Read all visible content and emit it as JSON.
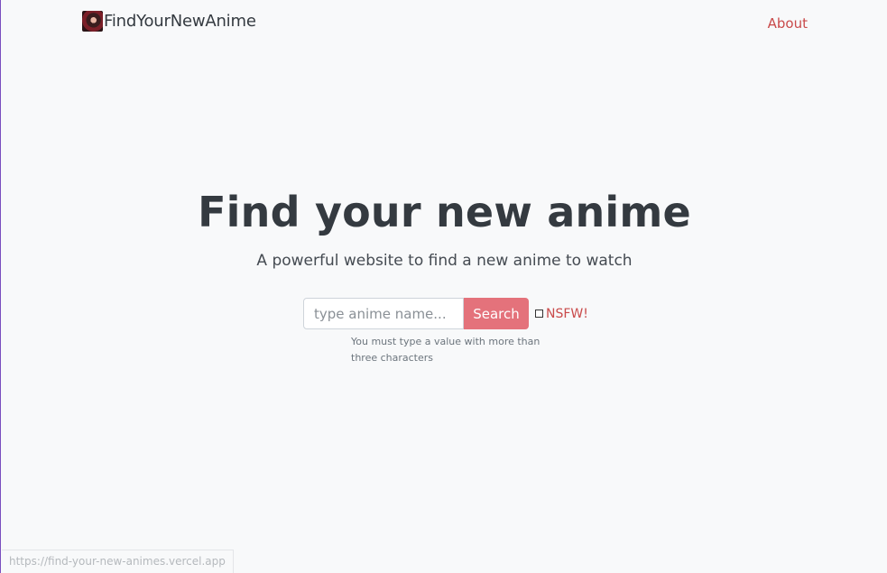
{
  "navbar": {
    "brand": {
      "logo_icon": "anime-character-logo",
      "title": "FindYourNewAnime"
    },
    "about_link": "About"
  },
  "hero": {
    "title": "Find your new anime",
    "subtitle": "A powerful website to find a new anime to watch"
  },
  "search": {
    "input_value": "",
    "placeholder": "type anime name...",
    "button_label": "Search",
    "nsfw_checked": false,
    "nsfw_label": "NSFW!",
    "help_text": "You must type a value with more than three characters"
  },
  "status_bar": {
    "url": "https://find-your-new-animes.vercel.app"
  },
  "colors": {
    "accent": "#e4727b",
    "link": "#c94a4a",
    "heading": "#343a40",
    "background": "#f8f9fa"
  }
}
